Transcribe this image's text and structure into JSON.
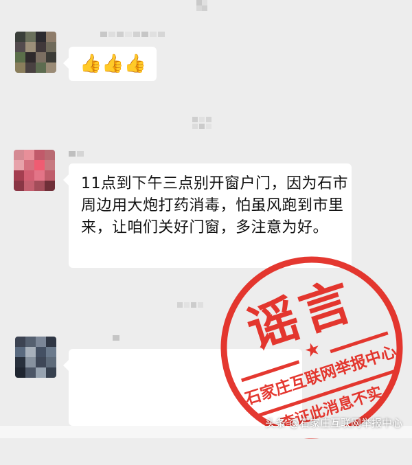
{
  "messages": [
    {
      "sender": "",
      "content": "👍👍👍"
    },
    {
      "sender": "",
      "content": "11点到下午三点别开窗户门，因为石市周边用大炮打药消毒，怕虽风跑到市里来，让咱们关好门窗，多注意为好。"
    },
    {
      "sender": "",
      "content": ""
    }
  ],
  "stamp": {
    "main_text": "谣言",
    "line1": "石家庄互联网举报中心",
    "line2": "查证此消息不实",
    "color": "#e2231a"
  },
  "watermark": "头条 @石家庄互联网举报中心"
}
